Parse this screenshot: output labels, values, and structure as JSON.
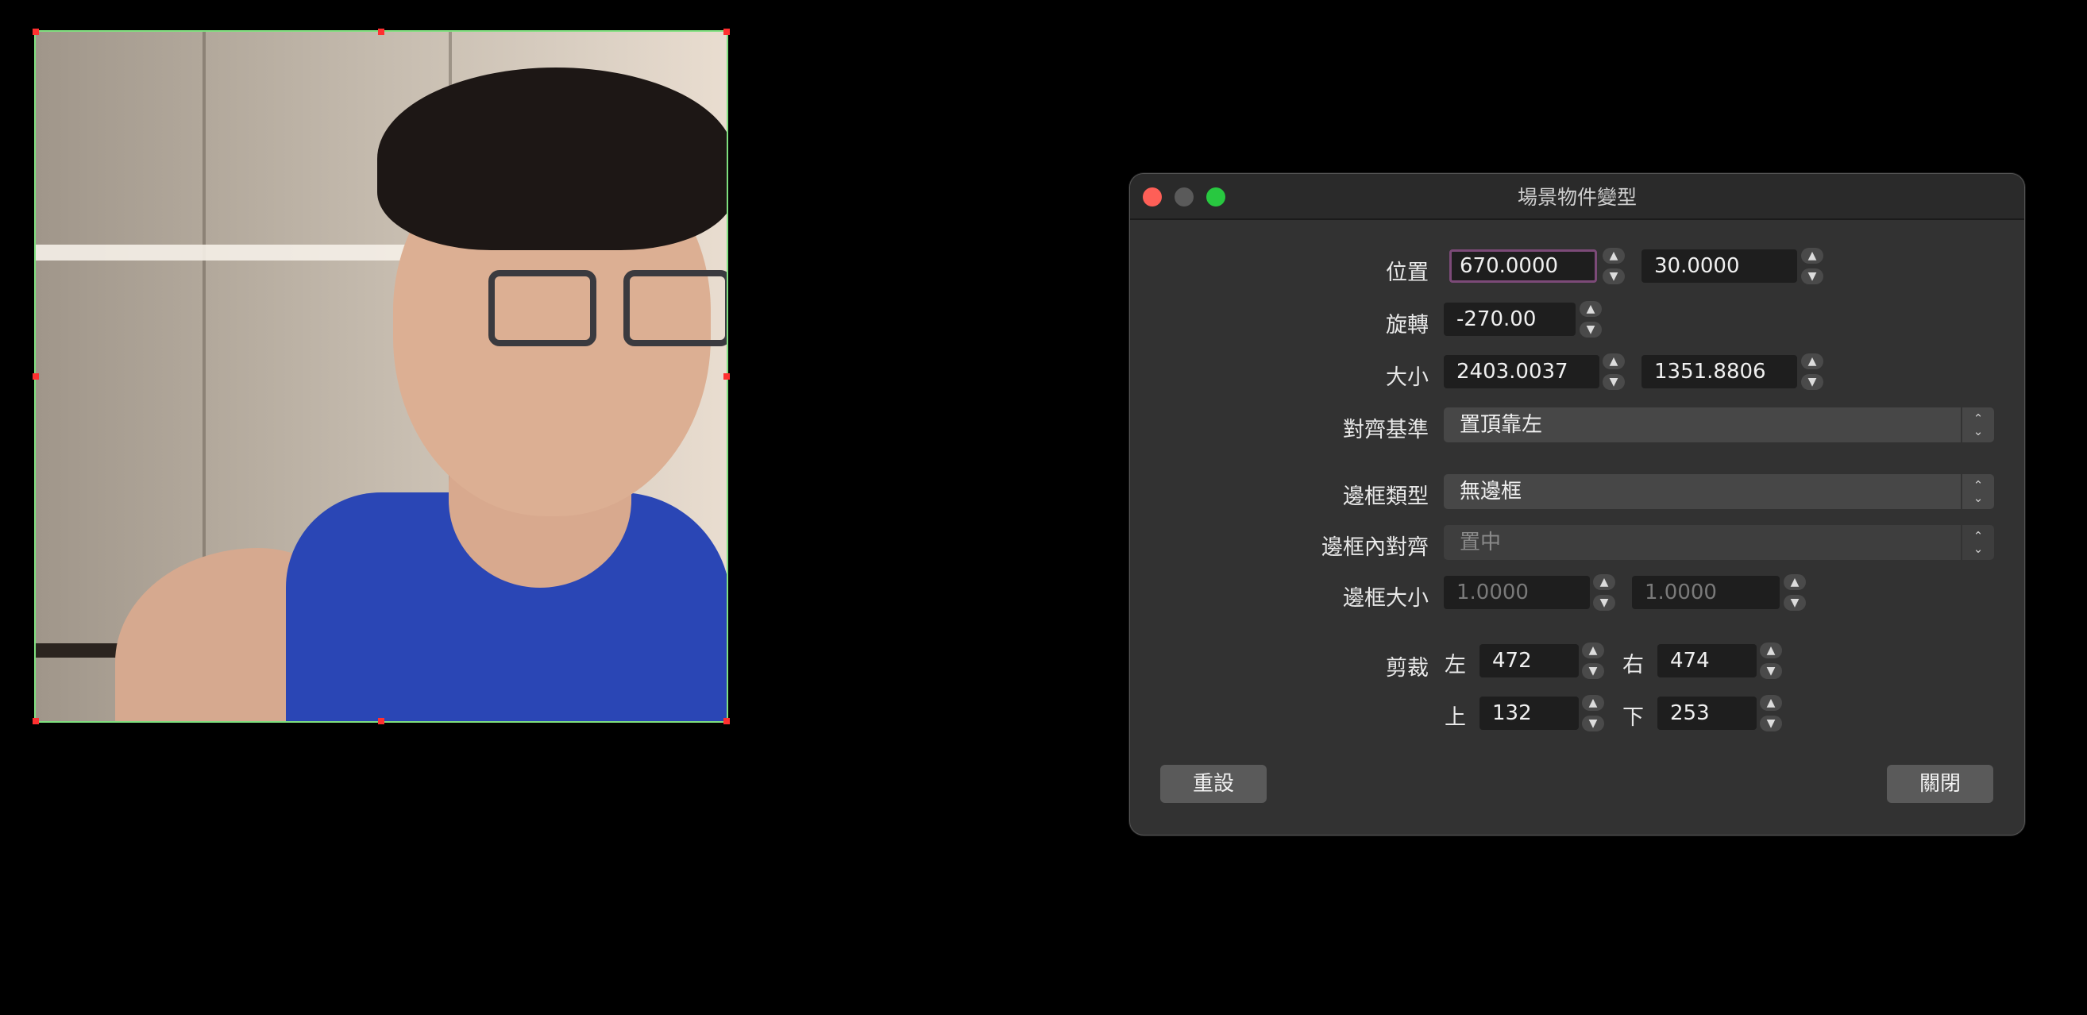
{
  "dialog": {
    "title": "場景物件變型",
    "position": {
      "label": "位置",
      "x": "670.0000",
      "y": "30.0000"
    },
    "rotation": {
      "label": "旋轉",
      "value": "-270.00"
    },
    "size": {
      "label": "大小",
      "width": "2403.0037",
      "height": "1351.8806"
    },
    "alignment": {
      "label": "對齊基準",
      "value": "置頂靠左"
    },
    "bounds_type": {
      "label": "邊框類型",
      "value": "無邊框"
    },
    "bounds_alignment": {
      "label": "邊框內對齊",
      "value": "置中"
    },
    "bounds_size": {
      "label": "邊框大小",
      "width": "1.0000",
      "height": "1.0000"
    },
    "crop": {
      "label": "剪裁",
      "left_label": "左",
      "left": "472",
      "right_label": "右",
      "right": "474",
      "top_label": "上",
      "top": "132",
      "bottom_label": "下",
      "bottom": "253"
    },
    "buttons": {
      "reset": "重設",
      "close": "關閉"
    }
  },
  "icons": {
    "stepper_up": "▲",
    "stepper_down": "▼",
    "select_up": "⌃",
    "select_down": "⌄"
  },
  "colors": {
    "selection_outline": "#7fe07f",
    "handle": "#ff3030",
    "focus_ring": "#7c4a78"
  }
}
